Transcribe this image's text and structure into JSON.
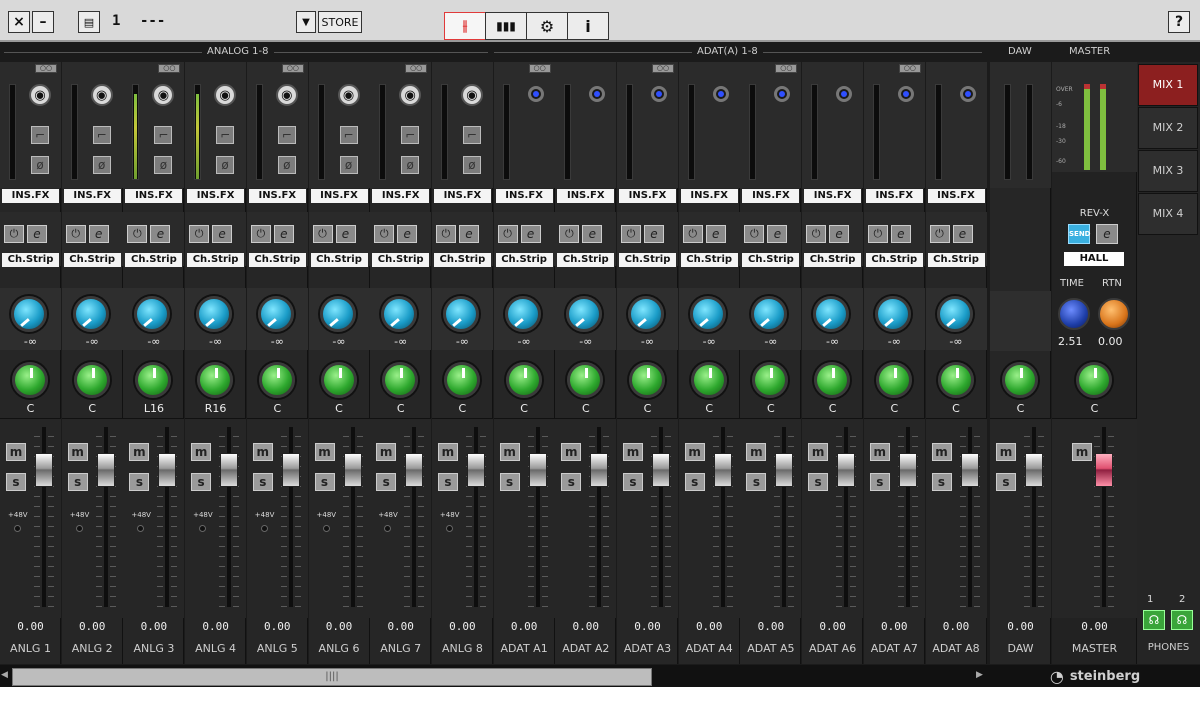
{
  "titlebar": {
    "close_label": "×",
    "minimize_label": "–",
    "scene_icon": "document-icon",
    "scene_number": "1",
    "scene_name": "---",
    "store_label": "STORE",
    "help_label": "?",
    "tabs": [
      "mixer",
      "meter",
      "settings",
      "info"
    ]
  },
  "sections": {
    "analog": "ANALOG 1-8",
    "adat": "ADAT(A) 1-8",
    "daw": "DAW",
    "master": "MASTER"
  },
  "channels": [
    {
      "name": "ANLG 1",
      "pan": "C",
      "send": "-∞",
      "level": "0.00",
      "ins_fx": "INS.FX",
      "ch_strip": "Ch.Strip",
      "phantom": "+48V",
      "meter_level": 0
    },
    {
      "name": "ANLG 2",
      "pan": "C",
      "send": "-∞",
      "level": "0.00",
      "ins_fx": "INS.FX",
      "ch_strip": "Ch.Strip",
      "phantom": "+48V",
      "meter_level": 0
    },
    {
      "name": "ANLG 3",
      "pan": "L16",
      "send": "-∞",
      "level": "0.00",
      "ins_fx": "INS.FX",
      "ch_strip": "Ch.Strip",
      "phantom": "+48V",
      "meter_level": 0.9
    },
    {
      "name": "ANLG 4",
      "pan": "R16",
      "send": "-∞",
      "level": "0.00",
      "ins_fx": "INS.FX",
      "ch_strip": "Ch.Strip",
      "phantom": "+48V",
      "meter_level": 0.9
    },
    {
      "name": "ANLG 5",
      "pan": "C",
      "send": "-∞",
      "level": "0.00",
      "ins_fx": "INS.FX",
      "ch_strip": "Ch.Strip",
      "phantom": "+48V",
      "meter_level": 0
    },
    {
      "name": "ANLG 6",
      "pan": "C",
      "send": "-∞",
      "level": "0.00",
      "ins_fx": "INS.FX",
      "ch_strip": "Ch.Strip",
      "phantom": "+48V",
      "meter_level": 0
    },
    {
      "name": "ANLG 7",
      "pan": "C",
      "send": "-∞",
      "level": "0.00",
      "ins_fx": "INS.FX",
      "ch_strip": "Ch.Strip",
      "phantom": "+48V",
      "meter_level": 0
    },
    {
      "name": "ANLG 8",
      "pan": "C",
      "send": "-∞",
      "level": "0.00",
      "ins_fx": "INS.FX",
      "ch_strip": "Ch.Strip",
      "phantom": "+48V",
      "meter_level": 0
    },
    {
      "name": "ADAT A1",
      "pan": "C",
      "send": "-∞",
      "level": "0.00",
      "ins_fx": "INS.FX",
      "ch_strip": "Ch.Strip",
      "meter_level": 0
    },
    {
      "name": "ADAT A2",
      "pan": "C",
      "send": "-∞",
      "level": "0.00",
      "ins_fx": "INS.FX",
      "ch_strip": "Ch.Strip",
      "meter_level": 0
    },
    {
      "name": "ADAT A3",
      "pan": "C",
      "send": "-∞",
      "level": "0.00",
      "ins_fx": "INS.FX",
      "ch_strip": "Ch.Strip",
      "meter_level": 0
    },
    {
      "name": "ADAT A4",
      "pan": "C",
      "send": "-∞",
      "level": "0.00",
      "ins_fx": "INS.FX",
      "ch_strip": "Ch.Strip",
      "meter_level": 0
    },
    {
      "name": "ADAT A5",
      "pan": "C",
      "send": "-∞",
      "level": "0.00",
      "ins_fx": "INS.FX",
      "ch_strip": "Ch.Strip",
      "meter_level": 0
    },
    {
      "name": "ADAT A6",
      "pan": "C",
      "send": "-∞",
      "level": "0.00",
      "ins_fx": "INS.FX",
      "ch_strip": "Ch.Strip",
      "meter_level": 0
    },
    {
      "name": "ADAT A7",
      "pan": "C",
      "send": "-∞",
      "level": "0.00",
      "ins_fx": "INS.FX",
      "ch_strip": "Ch.Strip",
      "meter_level": 0
    },
    {
      "name": "ADAT A8",
      "pan": "C",
      "send": "-∞",
      "level": "0.00",
      "ins_fx": "INS.FX",
      "ch_strip": "Ch.Strip",
      "meter_level": 0
    }
  ],
  "daw": {
    "name": "DAW",
    "pan": "C",
    "level": "0.00"
  },
  "master": {
    "name": "MASTER",
    "pan": "C",
    "level": "0.00",
    "meter_labels": [
      "OVER",
      "-6",
      "-18",
      "-30",
      "-60"
    ],
    "reverb_label": "REV-X",
    "reverb_send_label": "SEND",
    "reverb_type": "HALL",
    "time_label": "TIME",
    "rtn_label": "RTN",
    "time_value": "2.51",
    "rtn_value": "0.00"
  },
  "mixes": [
    "MIX 1",
    "MIX 2",
    "MIX 3",
    "MIX 4"
  ],
  "phones": {
    "label": "PHONES",
    "ch1": "1",
    "ch2": "2"
  },
  "brand": "steinberg",
  "scroll_grip": "||||",
  "colors": {
    "accent_red": "#8c1f1f",
    "send_knob": "#1a9cc8",
    "pan_knob": "#2ea82e",
    "adat_led": "#2f4fff"
  }
}
